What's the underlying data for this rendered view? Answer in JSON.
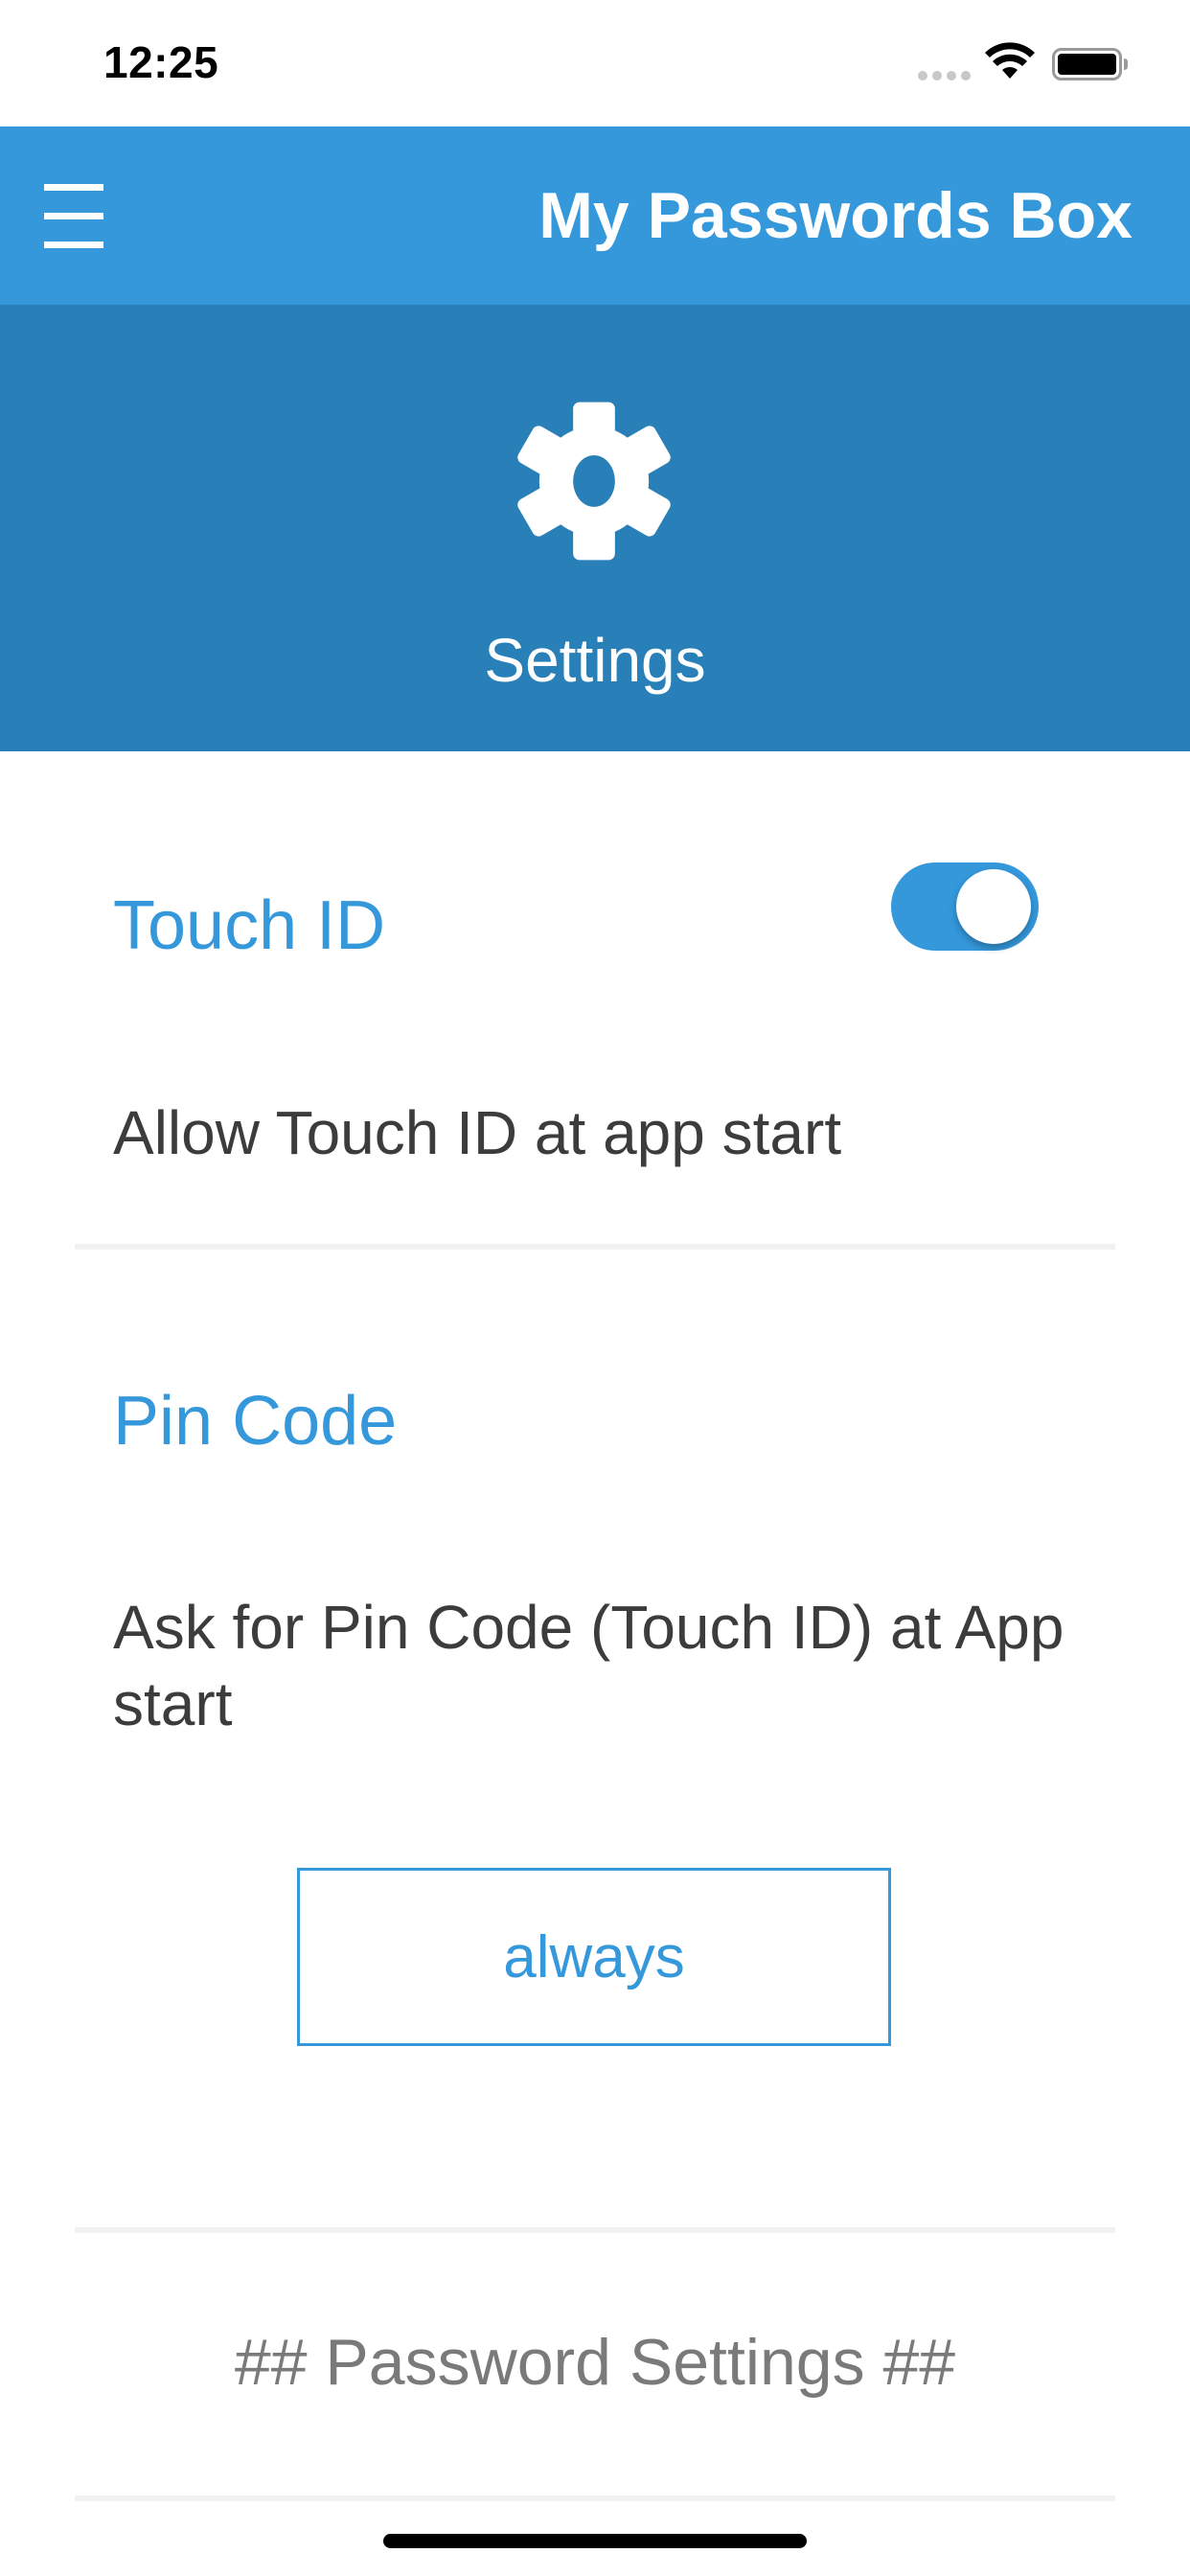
{
  "status_bar": {
    "time": "12:25"
  },
  "header": {
    "title": "My Passwords Box",
    "menu_icon": "hamburger-menu-icon"
  },
  "banner": {
    "icon": "gear-icon",
    "title": "Settings"
  },
  "touch_id": {
    "title": "Touch ID",
    "description": "Allow Touch ID at app start",
    "enabled": true
  },
  "pin_code": {
    "title": "Pin Code",
    "description": "Ask for Pin Code (Touch ID) at App start",
    "option_label": "always"
  },
  "password_settings": {
    "label": "## Password Settings ##"
  },
  "colors": {
    "header": "#3498db",
    "banner": "#2980b9",
    "accent": "#3498db",
    "text": "#3c3c3c",
    "muted_text": "#7a7a7a"
  }
}
